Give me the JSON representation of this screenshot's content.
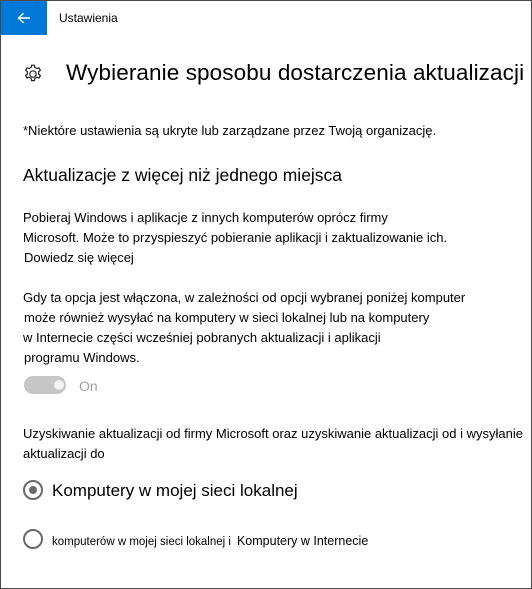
{
  "window": {
    "app_title": "Ustawienia",
    "back_icon": "back-arrow-icon",
    "accent_color": "#0078d7"
  },
  "header": {
    "settings_icon": "gear-icon",
    "title": "Wybieranie sposobu dostarczenia aktualizacji"
  },
  "note": "*Niektóre ustawienia są ukryte lub zarządzane przez Twoją organizację.",
  "section": {
    "heading": "Aktualizacje z więcej niż jednego miejsca",
    "description_lines": [
      "Pobieraj Windows i aplikacje z innych komputerów oprócz firmy",
      "Microsoft. Może to przyspieszyć pobieranie aplikacji i zaktualizowanie ich."
    ],
    "learn_more": "Dowiedz się więcej",
    "detail_lines": [
      "Gdy ta opcja jest włączona, w zależności od opcji wybranej poniżej komputer",
      "może również wysyłać na komputery w sieci lokalnej lub na komputery",
      "w Internecie części wcześniej pobranych aktualizacji i aplikacji",
      "programu Windows."
    ]
  },
  "toggle": {
    "state": "On",
    "enabled": true,
    "disabled_appearance": true
  },
  "source_prompt_lines": [
    "Uzyskiwanie aktualizacji od firmy Microsoft oraz uzyskiwanie aktualizacji od i wysyłanie",
    "aktualizacji do"
  ],
  "options": [
    {
      "label": "Komputery w mojej sieci lokalnej",
      "selected": true
    },
    {
      "label_part1": "komputerów w mojej sieci lokalnej i",
      "label_part2": "Komputery w Internecie",
      "selected": false
    }
  ]
}
